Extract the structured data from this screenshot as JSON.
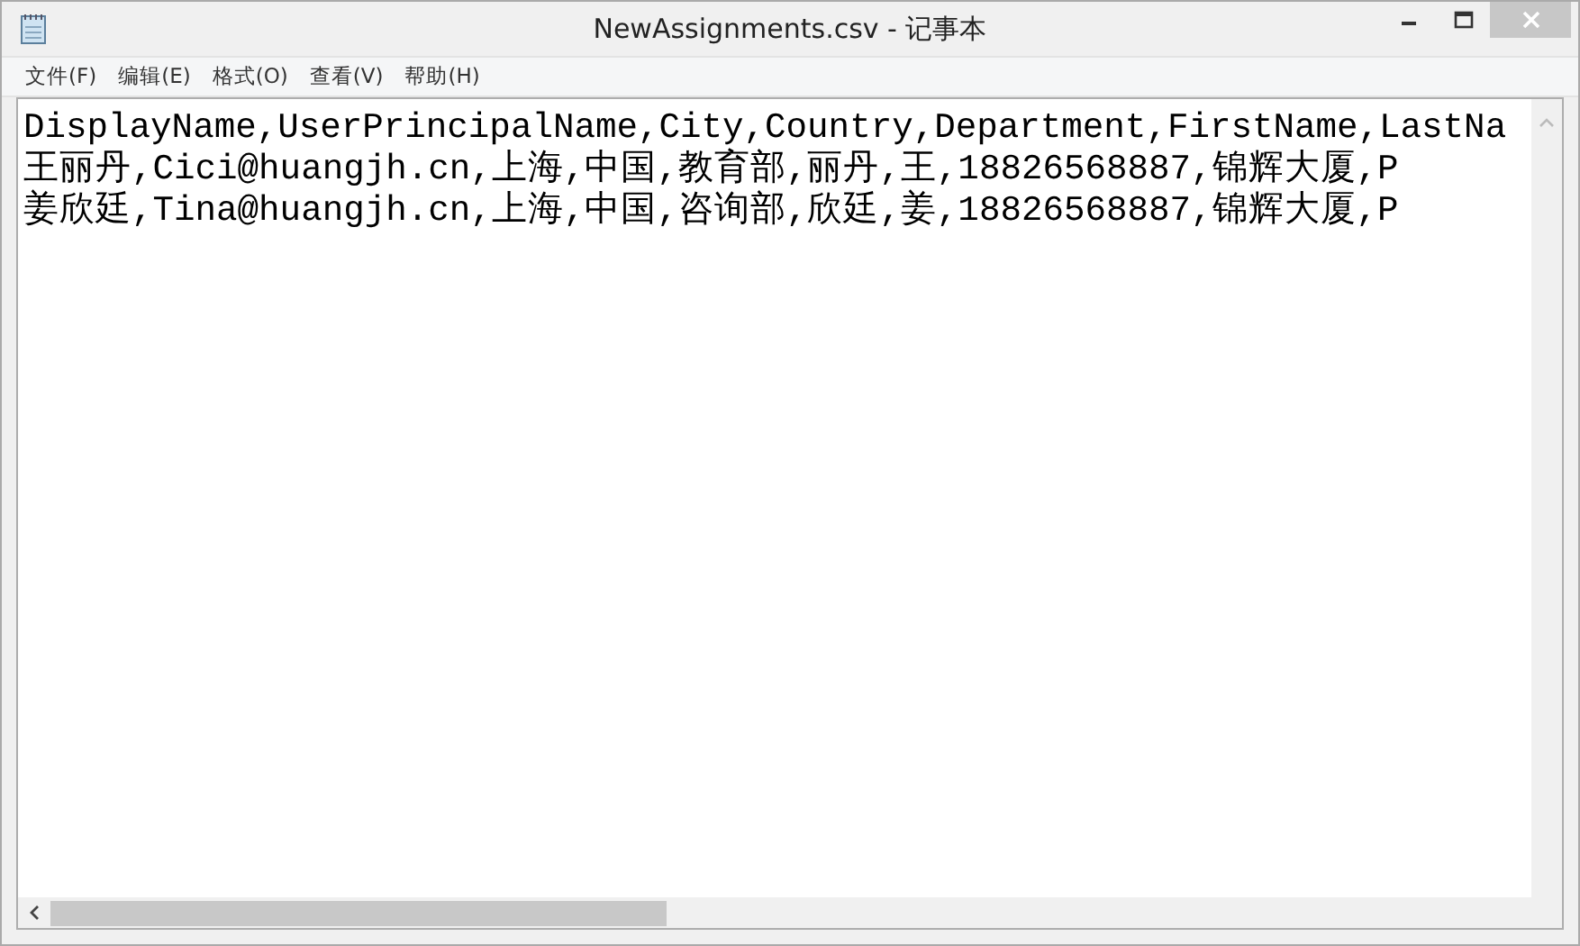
{
  "window": {
    "title": "NewAssignments.csv - 记事本"
  },
  "menu": [
    {
      "label": "文件(F)"
    },
    {
      "label": "编辑(E)"
    },
    {
      "label": "格式(O)"
    },
    {
      "label": "查看(V)"
    },
    {
      "label": "帮助(H)"
    }
  ],
  "document": {
    "lines": [
      "DisplayName,UserPrincipalName,City,Country,Department,FirstName,LastNa",
      "王丽丹,Cici@huangjh.cn,上海,中国,教育部,丽丹,王,18826568887,锦辉大厦,P",
      "姜欣廷,Tina@huangjh.cn,上海,中国,咨询部,欣廷,姜,18826568887,锦辉大厦,P"
    ]
  }
}
